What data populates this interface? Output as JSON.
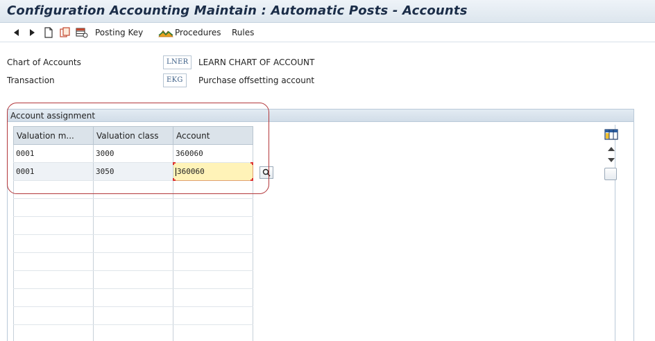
{
  "window": {
    "title": "Configuration Accounting Maintain : Automatic Posts - Accounts"
  },
  "toolbar": {
    "back_icon": "triangle-left-icon",
    "forward_icon": "triangle-right-icon",
    "new_icon": "new-document-icon",
    "copy_icon": "copy-icon",
    "config_icon": "table-settings-icon",
    "posting_key_label": "Posting Key",
    "procedures_label": "Procedures",
    "rules_label": "Rules"
  },
  "form": {
    "chart_of_accounts": {
      "label": "Chart of Accounts",
      "code": "LNER",
      "description": "LEARN CHART OF ACCOUNT"
    },
    "transaction": {
      "label": "Transaction",
      "code": "EKG",
      "description": "Purchase offsetting account"
    }
  },
  "panel": {
    "title": "Account assignment"
  },
  "table": {
    "columns": [
      "Valuation m...",
      "Valuation class",
      "Account"
    ],
    "rows": [
      {
        "valuation_modifier": "0001",
        "valuation_class": "3000",
        "account": "360060"
      },
      {
        "valuation_modifier": "0001",
        "valuation_class": "3050",
        "account": "360060"
      }
    ],
    "empty_rows": 9
  },
  "colors": {
    "header_bg": "#dde6ee",
    "title_color": "#1b2d48",
    "active_cell": "#fff3b8",
    "highlight_ring": "#b2363a"
  }
}
